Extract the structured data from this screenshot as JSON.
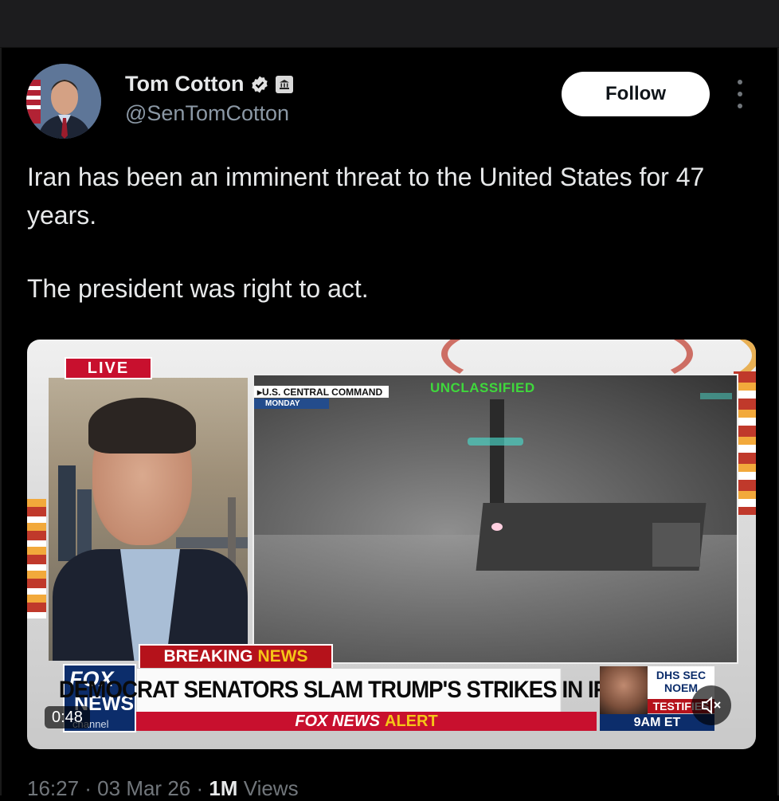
{
  "tweet": {
    "author_name": "Tom Cotton",
    "author_handle": "@SenTomCotton",
    "follow_label": "Follow",
    "text_line1": "Iran has been an imminent threat to the United States for 47 years.",
    "text_line2": "The president was right to act.",
    "timestamp": "16:27 · 03 Mar 26 · ",
    "views_count": "1M",
    "views_label": " Views"
  },
  "video": {
    "duration": "0:48",
    "live_label": "LIVE",
    "source_label": "U.S. CENTRAL COMMAND",
    "day_label": "MONDAY",
    "classification": "UNCLASSIFIED",
    "breaking_label": "BREAKING",
    "breaking_news_word": "NEWS",
    "headline": "DEMOCRAT SENATORS SLAM TRUMP'S STRIKES IN IRAN",
    "alert_brand": "FOX NEWS",
    "alert_word": "ALERT",
    "logo_fox": "FOX",
    "logo_news": "NEWS",
    "logo_channel": "channel",
    "promo_line1": "DHS SEC",
    "promo_line2": "NOEM",
    "promo_testify": "TESTIFIES",
    "promo_time": "9AM ET"
  },
  "icons": {
    "verified": "verified-check-icon",
    "gov": "government-badge-icon",
    "more": "more-options-icon",
    "mute": "muted-speaker-icon"
  },
  "colors": {
    "background": "#000000",
    "follow_button": "#ffffff",
    "secondary_text": "#71767b",
    "fox_red": "#c8102e",
    "fox_blue": "#0c2d6b",
    "classified_green": "#3fd83c"
  }
}
